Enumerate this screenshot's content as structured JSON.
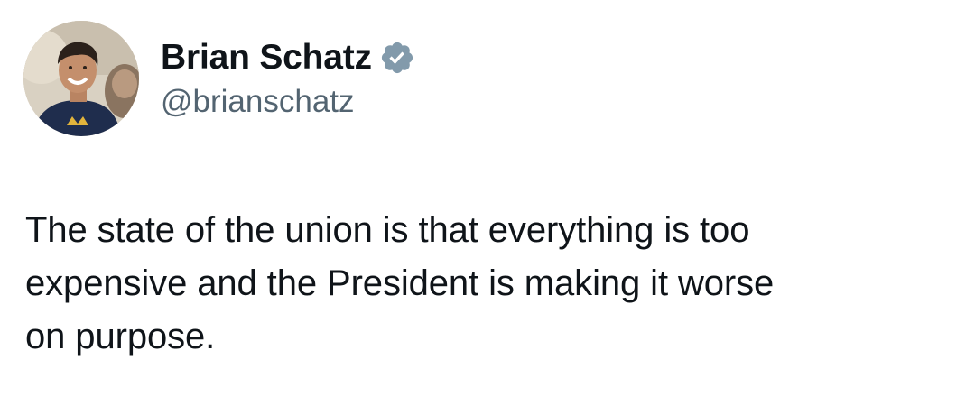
{
  "author": {
    "display_name": "Brian Schatz",
    "handle": "@brianschatz",
    "verified": true,
    "verified_color": "#829aab",
    "avatar_icon": "profile-photo"
  },
  "tweet": {
    "text_lines": [
      "The state of the union is that everything is too",
      "expensive and the President is making it worse",
      "on purpose."
    ]
  },
  "colors": {
    "text": "#0f1419",
    "handle": "#536471",
    "background": "#ffffff"
  }
}
